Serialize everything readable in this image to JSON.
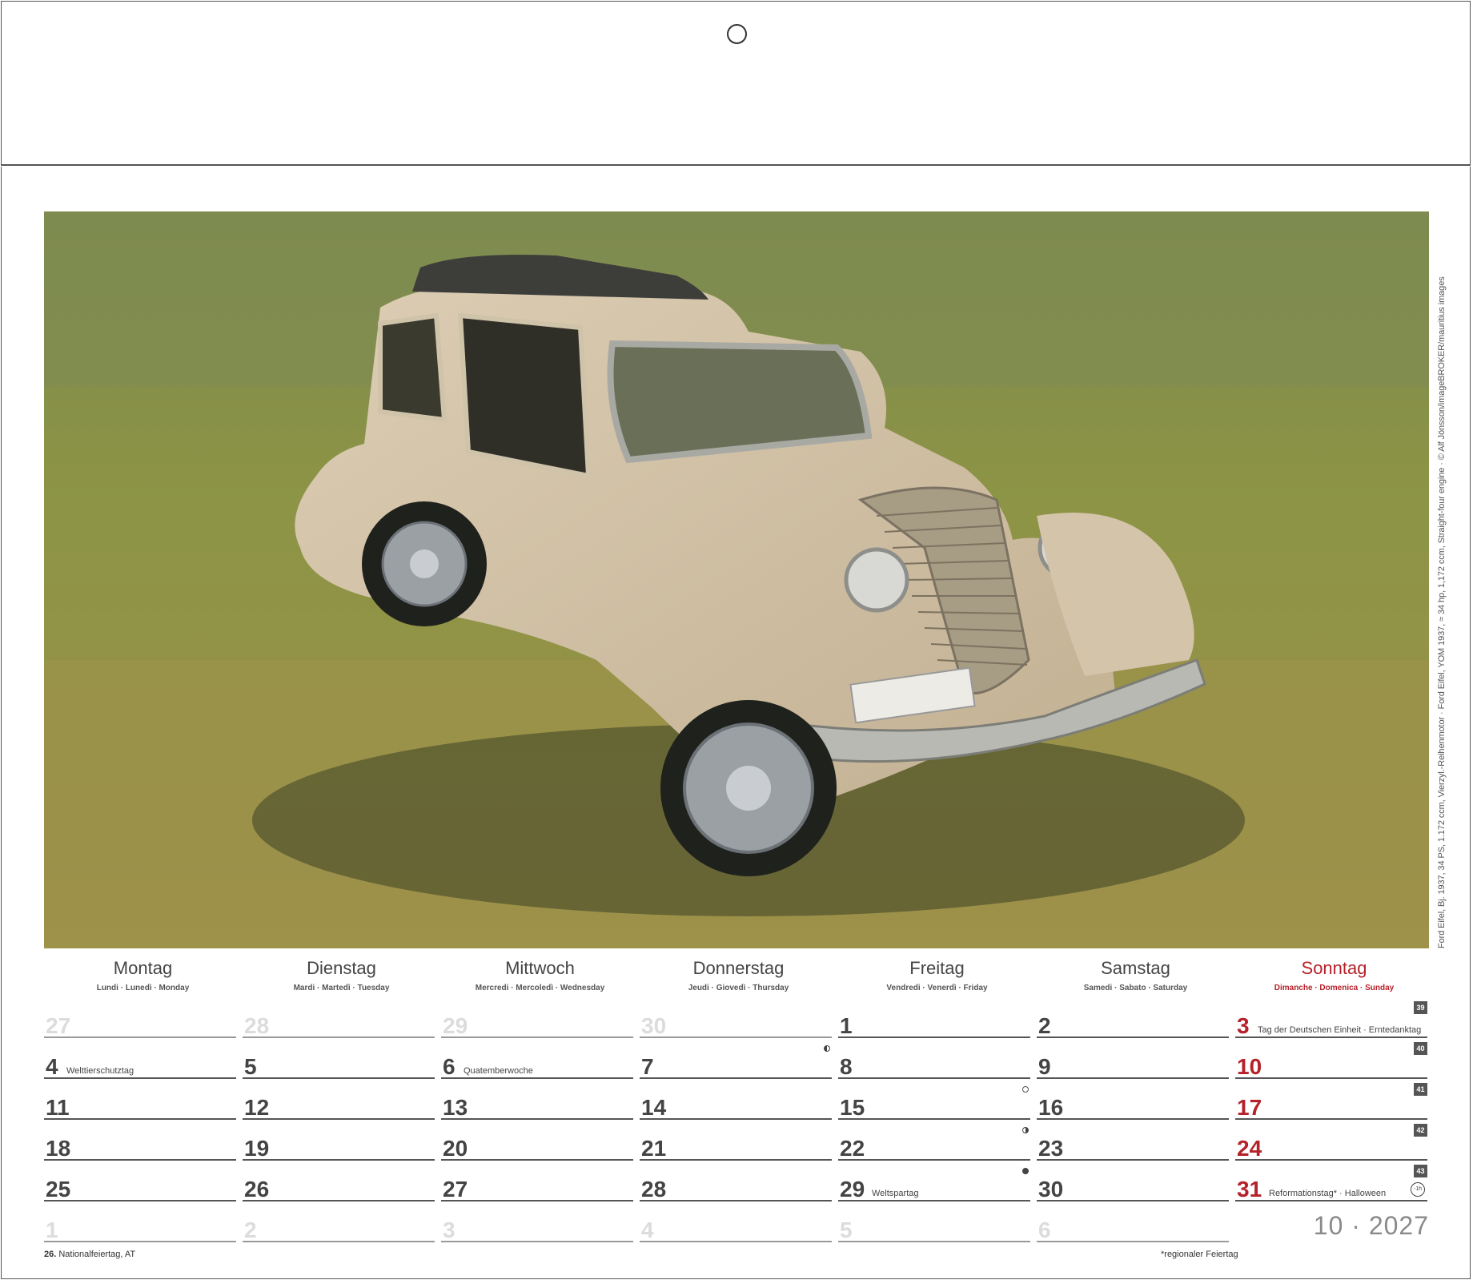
{
  "photo": {
    "alt": "Ford Eifel vintage car on a grass field",
    "credit": "Ford Eifel, Bj. 1937, 34 PS, 1.172 ccm, Vierzyl.-Reihenmotor · Ford Eifel, YOM 1937, ≈ 34 hp, 1,172 ccm, Straight-four engine · © Alf Jönsson/imageBROKER/mauritius images"
  },
  "weekdays": [
    {
      "name": "Montag",
      "sub": "Lundi · Lunedì · Monday"
    },
    {
      "name": "Dienstag",
      "sub": "Mardi · Martedì · Tuesday"
    },
    {
      "name": "Mittwoch",
      "sub": "Mercredi · Mercoledì · Wednesday"
    },
    {
      "name": "Donnerstag",
      "sub": "Jeudi · Giovedì · Thursday"
    },
    {
      "name": "Freitag",
      "sub": "Vendredi · Venerdì · Friday"
    },
    {
      "name": "Samstag",
      "sub": "Samedi · Sabato · Saturday"
    },
    {
      "name": "Sonntag",
      "sub": "Dimanche · Domenica · Sunday"
    }
  ],
  "weeks": [
    {
      "week": "39",
      "days": [
        {
          "n": "27",
          "faded": true
        },
        {
          "n": "28",
          "faded": true
        },
        {
          "n": "29",
          "faded": true
        },
        {
          "n": "30",
          "faded": true
        },
        {
          "n": "1"
        },
        {
          "n": "2"
        },
        {
          "n": "3",
          "note": "Tag der Deutschen Einheit  ·  Erntedanktag"
        }
      ]
    },
    {
      "week": "40",
      "days": [
        {
          "n": "4",
          "note": "Welttierschutztag"
        },
        {
          "n": "5"
        },
        {
          "n": "6",
          "note": "Quatemberwoche"
        },
        {
          "n": "7",
          "moon": "half-l"
        },
        {
          "n": "8"
        },
        {
          "n": "9"
        },
        {
          "n": "10"
        }
      ]
    },
    {
      "week": "41",
      "days": [
        {
          "n": "11"
        },
        {
          "n": "12"
        },
        {
          "n": "13"
        },
        {
          "n": "14"
        },
        {
          "n": "15",
          "moon": "full"
        },
        {
          "n": "16"
        },
        {
          "n": "17"
        }
      ]
    },
    {
      "week": "42",
      "days": [
        {
          "n": "18"
        },
        {
          "n": "19"
        },
        {
          "n": "20"
        },
        {
          "n": "21"
        },
        {
          "n": "22",
          "moon": "half-r"
        },
        {
          "n": "23"
        },
        {
          "n": "24"
        }
      ]
    },
    {
      "week": "43",
      "days": [
        {
          "n": "25"
        },
        {
          "n": "26"
        },
        {
          "n": "27"
        },
        {
          "n": "28"
        },
        {
          "n": "29",
          "note": "Weltspartag",
          "moon": "new"
        },
        {
          "n": "30"
        },
        {
          "n": "31",
          "note": "Reformationstag*  ·  Halloween",
          "dst": "-1h"
        }
      ]
    },
    {
      "week": "",
      "days": [
        {
          "n": "1",
          "faded": true
        },
        {
          "n": "2",
          "faded": true
        },
        {
          "n": "3",
          "faded": true
        },
        {
          "n": "4",
          "faded": true
        },
        {
          "n": "5",
          "faded": true
        },
        {
          "n": "6",
          "faded": true
        }
      ]
    }
  ],
  "month_label": "10 · 2027",
  "footer": {
    "left_bold": "26.",
    "left_text": " Nationalfeiertag, AT",
    "right": "*regionaler Feiertag"
  },
  "colors": {
    "sunday": "#b5222a",
    "text": "#444444",
    "faded": "#dcdcdc"
  }
}
